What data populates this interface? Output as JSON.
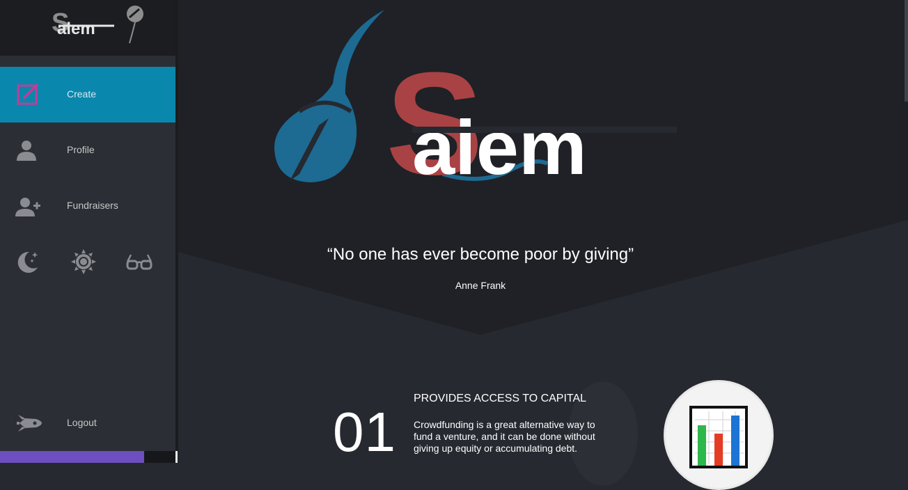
{
  "app": {
    "logo_text": "Salem"
  },
  "sidebar": {
    "items": [
      {
        "label": "Create",
        "icon": "edit-square-icon",
        "active": true
      },
      {
        "label": "Profile",
        "icon": "person-icon"
      },
      {
        "label": "Fundraisers",
        "icon": "person-add-icon"
      }
    ],
    "themes": [
      {
        "icon": "moon-stars-icon"
      },
      {
        "icon": "sun-icon"
      },
      {
        "icon": "glasses-icon"
      }
    ],
    "logout": {
      "label": "Logout",
      "icon": "rocket-icon"
    }
  },
  "hero": {
    "quote": "“No one has ever become poor by giving”",
    "author": "Anne Frank"
  },
  "features": [
    {
      "number": "01",
      "title": "PROVIDES ACCESS TO CAPITAL",
      "description": "Crowdfunding is a great alternative way to fund a venture, and it can be done without giving up equity or accumulating debt.",
      "icon": "bar-chart-icon"
    }
  ],
  "colors": {
    "accent": "#0a87ad",
    "brand_red": "#a94244",
    "brand_blue": "#1d6a93",
    "purple": "#6d4fbf"
  }
}
